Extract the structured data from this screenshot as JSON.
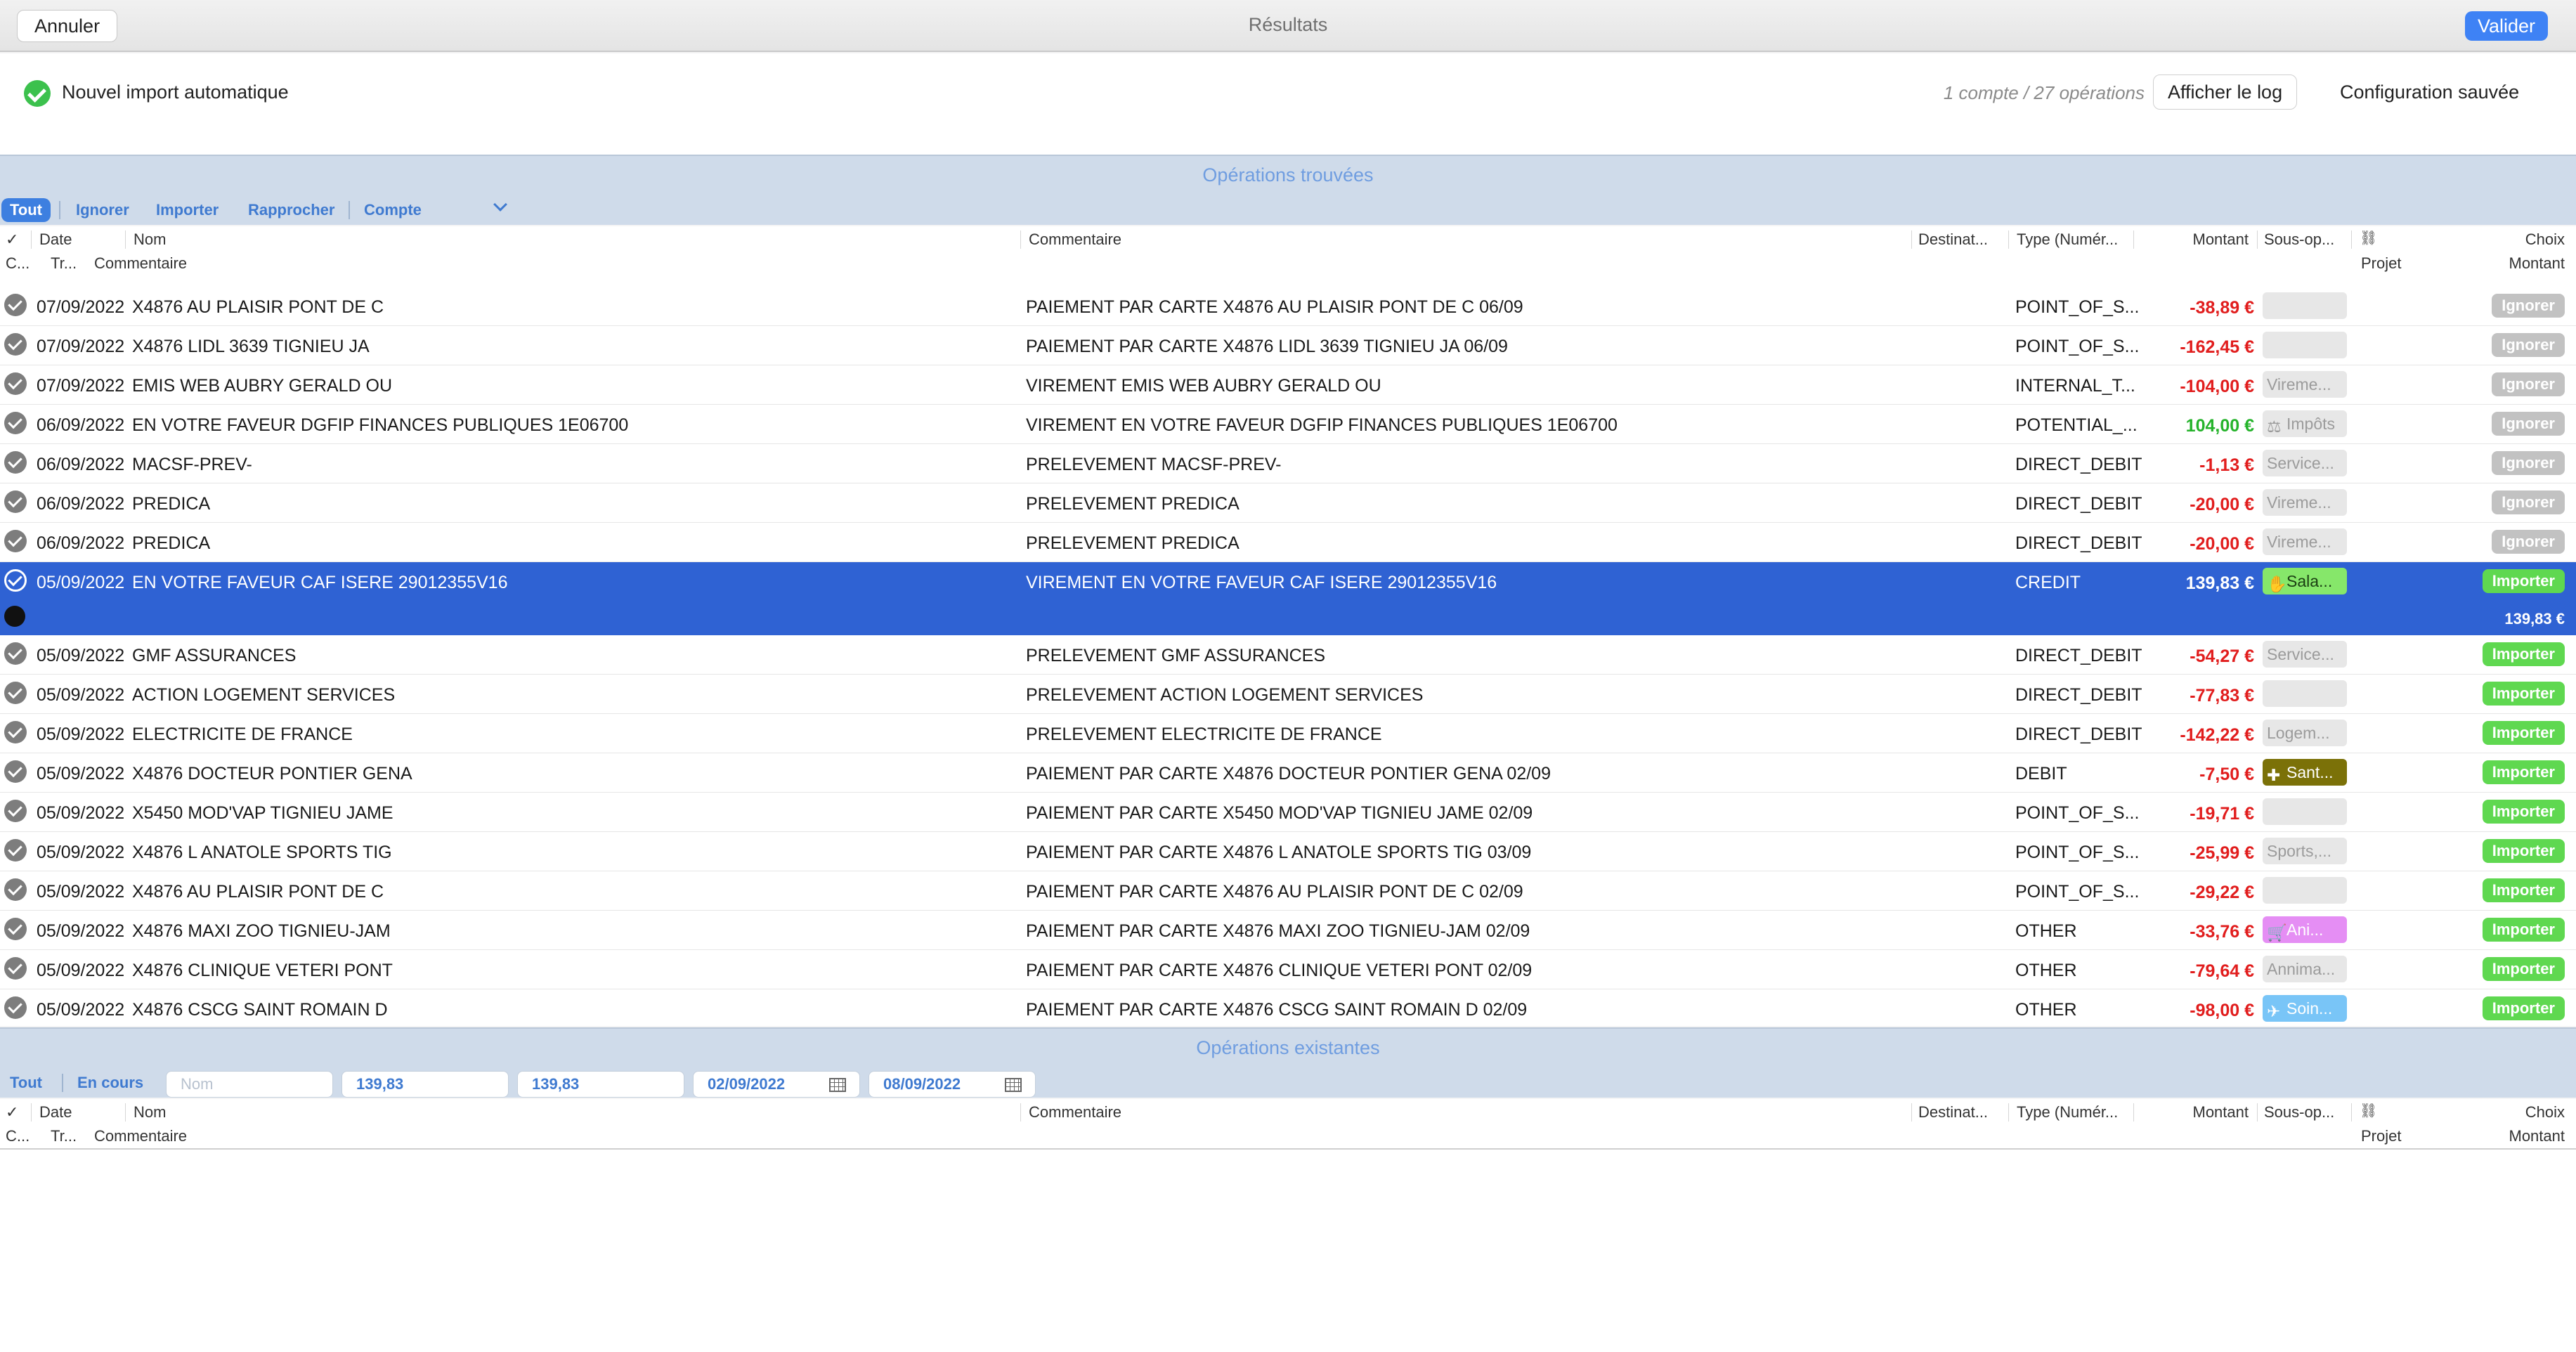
{
  "toolbar": {
    "cancel_label": "Annuler",
    "title": "Résultats",
    "validate_label": "Valider"
  },
  "info": {
    "import_label": "Nouvel import automatique",
    "counts": "1 compte / 27 opérations",
    "log_button": "Afficher le log",
    "config_status": "Configuration sauvée"
  },
  "found": {
    "title": "Opérations trouvées",
    "filters": [
      "Tout",
      "Ignorer",
      "Importer",
      "Rapprocher",
      "Compte"
    ]
  },
  "columns": {
    "check": "✓",
    "date": "Date",
    "name": "Nom",
    "comment": "Commentaire",
    "dest": "Destinat...",
    "type": "Type (Numér...",
    "amount": "Montant",
    "subop": "Sous-op...",
    "choice": "Choix",
    "sub_c": "C...",
    "sub_tr": "Tr...",
    "sub_comment": "Commentaire",
    "sub_project": "Projet",
    "sub_amount": "Montant"
  },
  "rows": [
    {
      "date": "07/09/2022",
      "name": "X4876 AU PLAISIR PONT DE C",
      "comment": "PAIEMENT PAR CARTE X4876 AU PLAISIR PONT DE C 06/09",
      "type": "POINT_OF_S...",
      "amount": "-38,89 €",
      "sign": "neg",
      "tag": "",
      "tag_style": "grey",
      "choice": "Ignorer"
    },
    {
      "date": "07/09/2022",
      "name": "X4876 LIDL 3639 TIGNIEU JA",
      "comment": "PAIEMENT PAR CARTE X4876 LIDL 3639 TIGNIEU JA 06/09",
      "type": "POINT_OF_S...",
      "amount": "-162,45 €",
      "sign": "neg",
      "tag": "",
      "tag_style": "grey",
      "choice": "Ignorer"
    },
    {
      "date": "07/09/2022",
      "name": "EMIS WEB AUBRY GERALD OU",
      "comment": "VIREMENT EMIS WEB AUBRY GERALD OU",
      "type": "INTERNAL_T...",
      "amount": "-104,00 €",
      "sign": "neg",
      "tag": "Vireme...",
      "tag_style": "grey",
      "choice": "Ignorer"
    },
    {
      "date": "06/09/2022",
      "name": "EN VOTRE FAVEUR DGFIP FINANCES PUBLIQUES 1E06700",
      "comment": "VIREMENT EN VOTRE FAVEUR DGFIP FINANCES PUBLIQUES 1E06700",
      "type": "POTENTIAL_...",
      "amount": "104,00 €",
      "sign": "pos",
      "tag": "Impôts",
      "tag_style": "grey",
      "tag_icon": "tax-icon",
      "choice": "Ignorer"
    },
    {
      "date": "06/09/2022",
      "name": "MACSF-PREV-",
      "comment": "PRELEVEMENT MACSF-PREV-",
      "type": "DIRECT_DEBIT",
      "amount": "-1,13 €",
      "sign": "neg",
      "tag": "Service...",
      "tag_style": "grey",
      "choice": "Ignorer"
    },
    {
      "date": "06/09/2022",
      "name": "PREDICA",
      "comment": "PRELEVEMENT PREDICA",
      "type": "DIRECT_DEBIT",
      "amount": "-20,00 €",
      "sign": "neg",
      "tag": "Vireme...",
      "tag_style": "grey",
      "choice": "Ignorer"
    },
    {
      "date": "06/09/2022",
      "name": "PREDICA",
      "comment": "PRELEVEMENT PREDICA",
      "type": "DIRECT_DEBIT",
      "amount": "-20,00 €",
      "sign": "neg",
      "tag": "Vireme...",
      "tag_style": "grey",
      "choice": "Ignorer"
    },
    {
      "date": "05/09/2022",
      "name": "EN VOTRE FAVEUR CAF ISERE 29012355V16",
      "comment": "VIREMENT EN VOTRE FAVEUR CAF ISERE 29012355V16",
      "type": "CREDIT",
      "amount": "139,83 €",
      "sign": "pos",
      "tag": "Sala...",
      "tag_style": "green",
      "tag_icon": "salary-icon",
      "choice": "Importer",
      "selected": true,
      "sub_amount": "139,83 €"
    },
    {
      "date": "05/09/2022",
      "name": "GMF ASSURANCES",
      "comment": "PRELEVEMENT GMF ASSURANCES",
      "type": "DIRECT_DEBIT",
      "amount": "-54,27 €",
      "sign": "neg",
      "tag": "Service...",
      "tag_style": "grey",
      "choice": "Importer"
    },
    {
      "date": "05/09/2022",
      "name": "ACTION LOGEMENT SERVICES",
      "comment": "PRELEVEMENT ACTION LOGEMENT SERVICES",
      "type": "DIRECT_DEBIT",
      "amount": "-77,83 €",
      "sign": "neg",
      "tag": "",
      "tag_style": "grey",
      "choice": "Importer"
    },
    {
      "date": "05/09/2022",
      "name": "ELECTRICITE DE FRANCE",
      "comment": "PRELEVEMENT ELECTRICITE DE FRANCE",
      "type": "DIRECT_DEBIT",
      "amount": "-142,22 €",
      "sign": "neg",
      "tag": "Logem...",
      "tag_style": "grey",
      "choice": "Importer"
    },
    {
      "date": "05/09/2022",
      "name": "X4876 DOCTEUR PONTIER GENA",
      "comment": "PAIEMENT PAR CARTE X4876 DOCTEUR PONTIER GENA 02/09",
      "type": "DEBIT",
      "amount": "-7,50 €",
      "sign": "neg",
      "tag": "Sant...",
      "tag_style": "olive",
      "tag_icon": "health-icon",
      "choice": "Importer"
    },
    {
      "date": "05/09/2022",
      "name": "X5450 MOD'VAP TIGNIEU JAME",
      "comment": "PAIEMENT PAR CARTE X5450 MOD'VAP TIGNIEU JAME 02/09",
      "type": "POINT_OF_S...",
      "amount": "-19,71 €",
      "sign": "neg",
      "tag": "",
      "tag_style": "grey",
      "choice": "Importer"
    },
    {
      "date": "05/09/2022",
      "name": "X4876 L ANATOLE SPORTS TIG",
      "comment": "PAIEMENT PAR CARTE X4876 L ANATOLE SPORTS TIG 03/09",
      "type": "POINT_OF_S...",
      "amount": "-25,99 €",
      "sign": "neg",
      "tag": "Sports,...",
      "tag_style": "grey",
      "choice": "Importer"
    },
    {
      "date": "05/09/2022",
      "name": "X4876 AU PLAISIR PONT DE C",
      "comment": "PAIEMENT PAR CARTE X4876 AU PLAISIR PONT DE C 02/09",
      "type": "POINT_OF_S...",
      "amount": "-29,22 €",
      "sign": "neg",
      "tag": "",
      "tag_style": "grey",
      "choice": "Importer"
    },
    {
      "date": "05/09/2022",
      "name": "X4876 MAXI ZOO TIGNIEU-JAM",
      "comment": "PAIEMENT PAR CARTE X4876 MAXI ZOO TIGNIEU-JAM 02/09",
      "type": "OTHER",
      "amount": "-33,76 €",
      "sign": "neg",
      "tag": "Ani...",
      "tag_style": "pink",
      "tag_icon": "cart-icon",
      "choice": "Importer"
    },
    {
      "date": "05/09/2022",
      "name": "X4876 CLINIQUE VETERI PONT",
      "comment": "PAIEMENT PAR CARTE X4876 CLINIQUE VETERI PONT 02/09",
      "type": "OTHER",
      "amount": "-79,64 €",
      "sign": "neg",
      "tag": "Annima...",
      "tag_style": "grey",
      "choice": "Importer"
    },
    {
      "date": "05/09/2022",
      "name": "X4876 CSCG SAINT ROMAIN D",
      "comment": "PAIEMENT PAR CARTE X4876 CSCG SAINT ROMAIN D 02/09",
      "type": "OTHER",
      "amount": "-98,00 €",
      "sign": "neg",
      "tag": "Soin...",
      "tag_style": "blue",
      "tag_icon": "care-icon",
      "choice": "Importer"
    }
  ],
  "existing": {
    "title": "Opérations existantes",
    "filters": [
      "Tout",
      "En cours"
    ],
    "name_placeholder": "Nom",
    "amount_min": "139,83",
    "amount_max": "139,83",
    "date_from": "02/09/2022",
    "date_to": "08/09/2022"
  }
}
